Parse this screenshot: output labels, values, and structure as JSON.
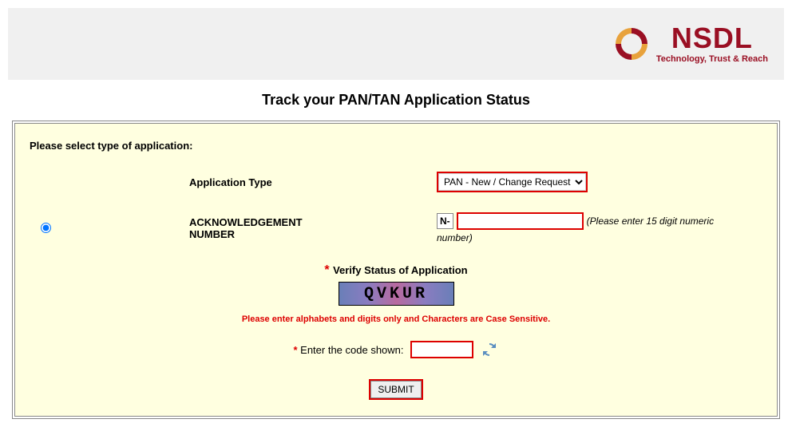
{
  "logo": {
    "title": "NSDL",
    "tagline": "Technology, Trust & Reach"
  },
  "page_title": "Track your PAN/TAN Application Status",
  "instruction": "Please select type of application:",
  "app_type": {
    "label": "Application Type",
    "selected": "PAN - New / Change Request",
    "options": [
      "PAN - New / Change Request"
    ]
  },
  "ack": {
    "label": "ACKNOWLEDGEMENT NUMBER",
    "prefix": "N-",
    "value": "",
    "hint_inline": "(Please enter 15 digit numeric",
    "hint_block": "number)"
  },
  "verify": {
    "label": "Verify Status of Application",
    "captcha_text": "QVKUR",
    "note": "Please enter alphabets and digits only and Characters are Case Sensitive."
  },
  "code": {
    "label": "Enter the code shown:",
    "value": ""
  },
  "submit_label": "SUBMIT"
}
